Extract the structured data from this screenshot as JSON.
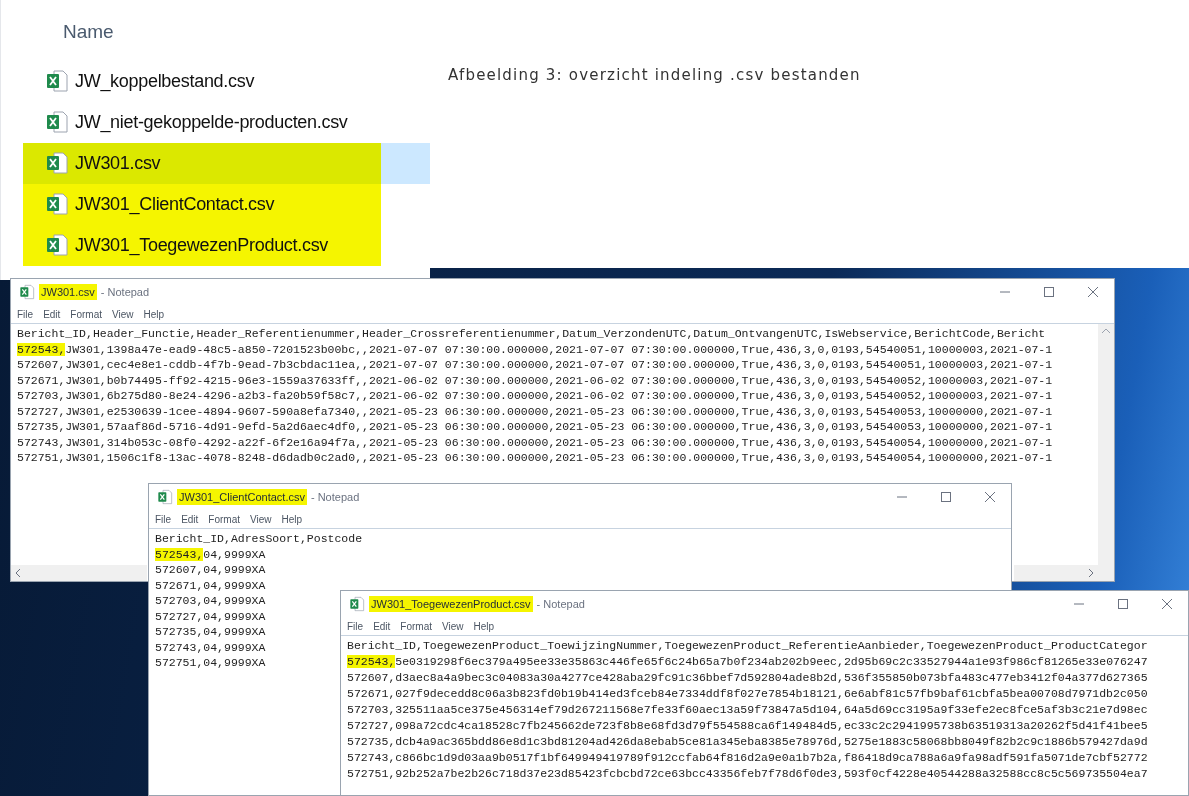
{
  "explorer": {
    "column_header": "Name",
    "files": [
      {
        "name": "JW_koppelbestand.csv",
        "selected": false,
        "highlighted": false
      },
      {
        "name": "JW_niet-gekoppelde-producten.csv",
        "selected": false,
        "highlighted": false
      },
      {
        "name": "JW301.csv",
        "selected": true,
        "highlighted": true
      },
      {
        "name": "JW301_ClientContact.csv",
        "selected": false,
        "highlighted": true
      },
      {
        "name": "JW301_ToegewezenProduct.csv",
        "selected": false,
        "highlighted": true
      }
    ]
  },
  "caption": "Afbeelding 3: overzicht indeling .csv bestanden",
  "windows": [
    {
      "title": {
        "file": "JW301.csv",
        "suffix": "- Notepad",
        "highlighted": true
      },
      "menu": [
        "File",
        "Edit",
        "Format",
        "View",
        "Help"
      ],
      "scrollbars": true,
      "lines": [
        {
          "text": "Bericht_ID,Header_Functie,Header_Referentienummer,Header_Crossreferentienummer,Datum_VerzondenUTC,Datum_OntvangenUTC,IsWebservice,BerichtCode,Bericht"
        },
        {
          "marked": "572543,",
          "text": "JW301,1398a47e-ead9-48c5-a850-7201523b00bc,,2021-07-07 07:30:00.000000,2021-07-07 07:30:00.000000,True,436,3,0,0193,54540051,10000003,2021-07-1"
        },
        {
          "text": "572607,JW301,cec4e8e1-cddb-4f7b-9ead-7b3cbdac11ea,,2021-07-07 07:30:00.000000,2021-07-07 07:30:00.000000,True,436,3,0,0193,54540051,10000003,2021-07-1"
        },
        {
          "text": "572671,JW301,b0b74495-ff92-4215-96e3-1559a37633ff,,2021-06-02 07:30:00.000000,2021-06-02 07:30:00.000000,True,436,3,0,0193,54540052,10000003,2021-07-1"
        },
        {
          "text": "572703,JW301,6b275d80-8e24-4296-a2b3-fa20b59f58c7,,2021-06-02 07:30:00.000000,2021-06-02 07:30:00.000000,True,436,3,0,0193,54540052,10000003,2021-07-1"
        },
        {
          "text": "572727,JW301,e2530639-1cee-4894-9607-590a8efa7340,,2021-05-23 06:30:00.000000,2021-05-23 06:30:00.000000,True,436,3,0,0193,54540053,10000000,2021-07-1"
        },
        {
          "text": "572735,JW301,57aaf86d-5716-4d91-9efd-5a2d6aec4df0,,2021-05-23 06:30:00.000000,2021-05-23 06:30:00.000000,True,436,3,0,0193,54540053,10000000,2021-07-1"
        },
        {
          "text": "572743,JW301,314b053c-08f0-4292-a22f-6f2e16a94f7a,,2021-05-23 06:30:00.000000,2021-05-23 06:30:00.000000,True,436,3,0,0193,54540054,10000000,2021-07-1"
        },
        {
          "text": "572751,JW301,1506c1f8-13ac-4078-8248-d6dadb0c2ad0,,2021-05-23 06:30:00.000000,2021-05-23 06:30:00.000000,True,436,3,0,0193,54540054,10000000,2021-07-1"
        }
      ]
    },
    {
      "title": {
        "file": "JW301_ClientContact.csv",
        "suffix": "- Notepad",
        "highlighted": true
      },
      "menu": [
        "File",
        "Edit",
        "Format",
        "View",
        "Help"
      ],
      "scrollbars": false,
      "lines": [
        {
          "text": "Bericht_ID,AdresSoort,Postcode"
        },
        {
          "marked": "572543,",
          "text": "04,9999XA"
        },
        {
          "text": "572607,04,9999XA"
        },
        {
          "text": "572671,04,9999XA"
        },
        {
          "text": "572703,04,9999XA"
        },
        {
          "text": "572727,04,9999XA"
        },
        {
          "text": "572735,04,9999XA"
        },
        {
          "text": "572743,04,9999XA"
        },
        {
          "text": "572751,04,9999XA"
        }
      ]
    },
    {
      "title": {
        "file": "JW301_ToegewezenProduct.csv",
        "suffix": "- Notepad",
        "highlighted": true
      },
      "menu": [
        "File",
        "Edit",
        "Format",
        "View",
        "Help"
      ],
      "scrollbars": false,
      "lines": [
        {
          "text": "Bericht_ID,ToegewezenProduct_ToewijzingNummer,ToegewezenProduct_ReferentieAanbieder,ToegewezenProduct_ProductCategor"
        },
        {
          "marked": "572543,",
          "text": "5e0319298f6ec379a495ee33e35863c446fe65f6c24b65a7b0f234ab202b9eec,2d95b69c2c33527944a1e93f986cf81265e33e076247"
        },
        {
          "text": "572607,d3aec8a4a9bec3c04083a30a4277ce428aba29fc91c36bbef7d592804ade8b2d,536f355850b073bfa483c477eb3412f04a377d627365"
        },
        {
          "text": "572671,027f9decedd8c06a3b823fd0b19b414ed3fceb84e7334ddf8f027e7854b18121,6e6abf81c57fb9baf61cbfa5bea00708d7971db2c050"
        },
        {
          "text": "572703,325511aa5ce375e456314ef79d267211568e7fe33f60aec13a59f73847a5d104,64a5d69cc3195a9f33efe2ec8fce5af3b3c21e7d98ec"
        },
        {
          "text": "572727,098a72cdc4ca18528c7fb245662de723f8b8e68fd3d79f554588ca6f149484d5,ec33c2c2941995738b63519313a20262f5d41f41bee5"
        },
        {
          "text": "572735,dcb4a9ac365bdd86e8d1c3bd81204ad426da8ebab5ce81a345eba8385e78976d,5275e1883c58068bb8049f82b2c9c1886b579427da9d"
        },
        {
          "text": "572743,c866bc1d9d03aa9b0517f1bf649949419789f912ccfab64f816d2a9e0a1b7b2a,f86418d9ca788a6a9fa98adf591fa5071de7cbf52772"
        },
        {
          "text": "572751,92b252a7be2b26c718d37e23d85423fcbcbd72ce63bcc43356feb7f78d6f0de3,593f0cf4228e40544288a32588cc8c5c569735504ea7"
        }
      ]
    }
  ]
}
